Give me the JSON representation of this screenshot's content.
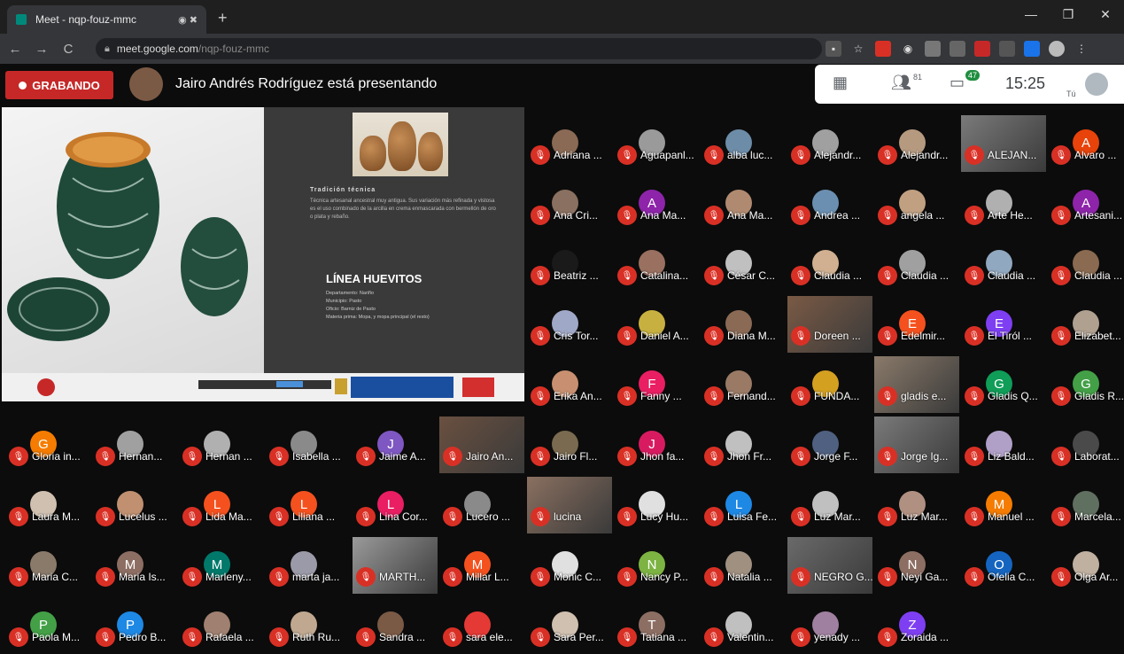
{
  "browser": {
    "tab_title": "Meet - nqp-fouz-mmc",
    "tab_controls": "◉ ✖",
    "new_tab": "+",
    "url_domain": "meet.google.com",
    "url_path": "/nqp-fouz-mmc",
    "window_controls": [
      "—",
      "❐",
      "✕"
    ]
  },
  "meet": {
    "recording_label": "GRABANDO",
    "presenting_text": "Jairo Andrés Rodríguez está presentando",
    "people_count": "81",
    "chat_count": "47",
    "time": "15:25",
    "you_label": "Tú"
  },
  "slide": {
    "subhead": "Tradición técnica",
    "body": "Técnica artesanal ancestral muy antigua. Sus variación más refinada y vistosa es el uso combinado de la arcilla en crema enmascarada con bermellón de oro o plata y rebaño.",
    "title": "LÍNEA HUEVITOS",
    "details": [
      "Departamento: Nariño",
      "Municipio: Pasto",
      "Oficio: Barniz de Pasto",
      "Materia prima: Mopa, y mopa principal (el resto)"
    ]
  },
  "colors": {
    "recording": "#c62828",
    "mic_muted": "#d93025",
    "background": "#0c0c0c"
  },
  "participants": [
    {
      "name": "Adriana ...",
      "initial": "",
      "color": "#8a6a55"
    },
    {
      "name": "Aguapanl...",
      "initial": "",
      "color": "#9a9a9a"
    },
    {
      "name": "alba luc...",
      "initial": "",
      "color": "#6c8ca8"
    },
    {
      "name": "Alejandr...",
      "initial": "",
      "color": "#a0a0a0"
    },
    {
      "name": "Alejandr...",
      "initial": "",
      "color": "#b59a80"
    },
    {
      "name": "ALEJAN...",
      "initial": "",
      "color": "#7a7a7a"
    },
    {
      "name": "Alvaro ...",
      "initial": "A",
      "color": "#e8430a"
    },
    {
      "name": "Ana Cri...",
      "initial": "",
      "color": "#8a7060"
    },
    {
      "name": "Ana Ma...",
      "initial": "A",
      "color": "#8e24aa"
    },
    {
      "name": "Ana Ma...",
      "initial": "",
      "color": "#b08a70"
    },
    {
      "name": "Andrea ...",
      "initial": "",
      "color": "#6a8fb0"
    },
    {
      "name": "angela ...",
      "initial": "",
      "color": "#c0a080"
    },
    {
      "name": "Arte He...",
      "initial": "",
      "color": "#b0b0b0"
    },
    {
      "name": "Artesani...",
      "initial": "A",
      "color": "#8e24aa"
    },
    {
      "name": "Beatriz ...",
      "initial": "",
      "color": "#1a1a1a"
    },
    {
      "name": "Catalina...",
      "initial": "",
      "color": "#9a7060"
    },
    {
      "name": "César C...",
      "initial": "",
      "color": "#c0c0c0"
    },
    {
      "name": "Claudia ...",
      "initial": "",
      "color": "#d0b090"
    },
    {
      "name": "Claudia ...",
      "initial": "",
      "color": "#a0a0a0"
    },
    {
      "name": "Claudia ...",
      "initial": "",
      "color": "#90a8c0"
    },
    {
      "name": "Claudia ...",
      "initial": "",
      "color": "#8a6a50"
    },
    {
      "name": "Cris Tor...",
      "initial": "",
      "color": "#a0a8c8"
    },
    {
      "name": "Daniel A...",
      "initial": "",
      "color": "#c8b040"
    },
    {
      "name": "Diana M...",
      "initial": "",
      "color": "#8a6a55"
    },
    {
      "name": "Doreen ...",
      "initial": "",
      "color": "#7a5a45"
    },
    {
      "name": "Edelmir...",
      "initial": "E",
      "color": "#f4511e"
    },
    {
      "name": "El Tiról ...",
      "initial": "E",
      "color": "#7e3ff2"
    },
    {
      "name": "Elizabet...",
      "initial": "",
      "color": "#b0a090"
    },
    {
      "name": "Erika An...",
      "initial": "",
      "color": "#c89070"
    },
    {
      "name": "Fanny ...",
      "initial": "F",
      "color": "#e91e63"
    },
    {
      "name": "Fernand...",
      "initial": "",
      "color": "#9a7a65"
    },
    {
      "name": "FUNDA...",
      "initial": "",
      "color": "#d4a020"
    },
    {
      "name": "gladis e...",
      "initial": "",
      "color": "#8a7a6a"
    },
    {
      "name": "Gladis Q...",
      "initial": "G",
      "color": "#0f9d58"
    },
    {
      "name": "Gladis R...",
      "initial": "G",
      "color": "#43a047"
    },
    {
      "name": "Gloria in...",
      "initial": "G",
      "color": "#f57c00"
    },
    {
      "name": "Hernan...",
      "initial": "",
      "color": "#a0a0a0"
    },
    {
      "name": "Hernan ...",
      "initial": "",
      "color": "#b0b0b0"
    },
    {
      "name": "Isabella ...",
      "initial": "",
      "color": "#8a8a8a"
    },
    {
      "name": "Jaime A...",
      "initial": "J",
      "color": "#7e57c2"
    },
    {
      "name": "Jairo An...",
      "initial": "",
      "color": "#6a5040"
    },
    {
      "name": "Jairo Fl...",
      "initial": "",
      "color": "#7a6a50"
    },
    {
      "name": "Jhon fa...",
      "initial": "J",
      "color": "#d81b60"
    },
    {
      "name": "Jhon Fr...",
      "initial": "",
      "color": "#c0c0c0"
    },
    {
      "name": "Jorge F...",
      "initial": "",
      "color": "#506080"
    },
    {
      "name": "Jorge Ig...",
      "initial": "",
      "color": "#7a7a7a"
    },
    {
      "name": "Liz Bald...",
      "initial": "",
      "color": "#b0a0c8"
    },
    {
      "name": "Laborat...",
      "initial": "",
      "color": "#4a4a4a"
    },
    {
      "name": "Laura M...",
      "initial": "",
      "color": "#d0c0b0"
    },
    {
      "name": "Lucelus ...",
      "initial": "",
      "color": "#c09070"
    },
    {
      "name": "Lida Ma...",
      "initial": "L",
      "color": "#f4511e"
    },
    {
      "name": "Liliana ...",
      "initial": "L",
      "color": "#f4511e"
    },
    {
      "name": "Lina Cor...",
      "initial": "L",
      "color": "#e91e63"
    },
    {
      "name": "Lucero ...",
      "initial": "",
      "color": "#8a8a8a"
    },
    {
      "name": "lucina",
      "initial": "",
      "color": "#8a7060"
    },
    {
      "name": "Lucy Hu...",
      "initial": "",
      "color": "#e0e0e0"
    },
    {
      "name": "Luisa Fe...",
      "initial": "L",
      "color": "#1e88e5"
    },
    {
      "name": "Luz Mar...",
      "initial": "",
      "color": "#c0c0c0"
    },
    {
      "name": "Luz Mar...",
      "initial": "",
      "color": "#b09080"
    },
    {
      "name": "Manuel ...",
      "initial": "M",
      "color": "#f57c00"
    },
    {
      "name": "Marcela...",
      "initial": "",
      "color": "#607060"
    },
    {
      "name": "Maria C...",
      "initial": "",
      "color": "#8a7a6a"
    },
    {
      "name": "Maria Is...",
      "initial": "M",
      "color": "#8d6e63"
    },
    {
      "name": "Marleny...",
      "initial": "M",
      "color": "#00796b"
    },
    {
      "name": "marta ja...",
      "initial": "",
      "color": "#9a9aa8"
    },
    {
      "name": "MARTH...",
      "initial": "",
      "color": "#9a9a9a"
    },
    {
      "name": "Millar L...",
      "initial": "M",
      "color": "#f4511e"
    },
    {
      "name": "Monic C...",
      "initial": "",
      "color": "#e0e0e0"
    },
    {
      "name": "Nancy P...",
      "initial": "N",
      "color": "#7cb342"
    },
    {
      "name": "Natalia ...",
      "initial": "",
      "color": "#a09080"
    },
    {
      "name": "NEGRO G...",
      "initial": "",
      "color": "#6a6a6a"
    },
    {
      "name": "Neyi Ga...",
      "initial": "N",
      "color": "#8d6e63"
    },
    {
      "name": "Ofelia C...",
      "initial": "O",
      "color": "#1565c0"
    },
    {
      "name": "Olga Ar...",
      "initial": "",
      "color": "#c0b0a0"
    },
    {
      "name": "Paola M...",
      "initial": "P",
      "color": "#43a047"
    },
    {
      "name": "Pedro B...",
      "initial": "P",
      "color": "#1e88e5"
    },
    {
      "name": "Rafaela ...",
      "initial": "",
      "color": "#a08070"
    },
    {
      "name": "Ruth Ru...",
      "initial": "",
      "color": "#c0a890"
    },
    {
      "name": "Sandra ...",
      "initial": "",
      "color": "#7a5a45"
    },
    {
      "name": "sara ele...",
      "initial": "",
      "color": "#e53935"
    },
    {
      "name": "Sara Per...",
      "initial": "",
      "color": "#d0c0b0"
    },
    {
      "name": "Tatiana ...",
      "initial": "T",
      "color": "#8d6e63"
    },
    {
      "name": "Valentin...",
      "initial": "",
      "color": "#c0c0c0"
    },
    {
      "name": "yenady ...",
      "initial": "",
      "color": "#a080a0"
    },
    {
      "name": "Zoraida ...",
      "initial": "Z",
      "color": "#7e3ff2"
    }
  ]
}
